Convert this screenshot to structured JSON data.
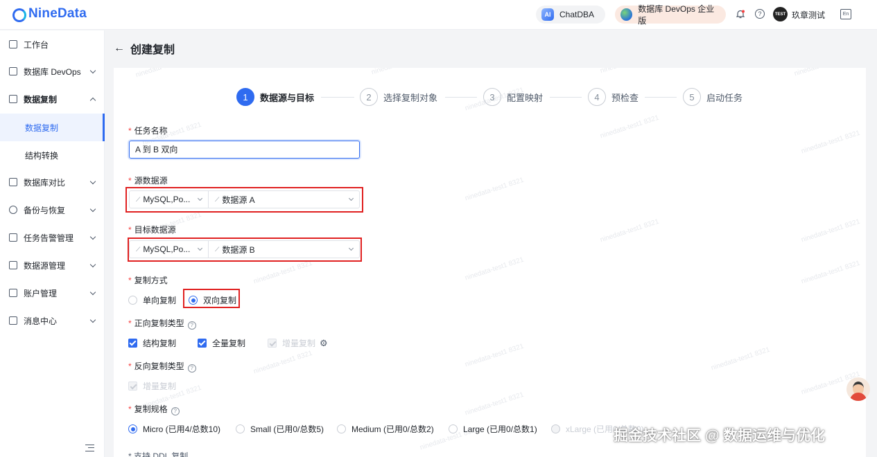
{
  "app": {
    "logo_text": "NineData",
    "brand_color": "#2f6bf0"
  },
  "topbar": {
    "chatdba_label": "ChatDBA",
    "chatdba_icon_text": "AI",
    "devops_label": "数据库 DevOps 企业版",
    "avatar_text": "TEST",
    "username": "玖章测试",
    "lang_icon_text": "En"
  },
  "sidebar": {
    "items": [
      {
        "label": "工作台",
        "icon": "home-icon"
      },
      {
        "label": "数据库 DevOps",
        "icon": "monitor-icon"
      },
      {
        "label": "数据复制",
        "icon": "copy-icon",
        "expanded": true
      },
      {
        "label": "数据复制",
        "sub": true,
        "active": true
      },
      {
        "label": "结构转换",
        "sub": true
      },
      {
        "label": "数据库对比",
        "icon": "compare-icon"
      },
      {
        "label": "备份与恢复",
        "icon": "cloud-icon"
      },
      {
        "label": "任务告警管理",
        "icon": "alarm-icon"
      },
      {
        "label": "数据源管理",
        "icon": "database-icon"
      },
      {
        "label": "账户管理",
        "icon": "account-icon"
      },
      {
        "label": "消息中心",
        "icon": "mail-icon"
      }
    ]
  },
  "page": {
    "back": "←",
    "title": "创建复制"
  },
  "steps": [
    {
      "num": "1",
      "label": "数据源与目标",
      "active": true
    },
    {
      "num": "2",
      "label": "选择复制对象"
    },
    {
      "num": "3",
      "label": "配置映射"
    },
    {
      "num": "4",
      "label": "预检查"
    },
    {
      "num": "5",
      "label": "启动任务"
    }
  ],
  "form": {
    "task_name_label": "任务名称",
    "task_name_value": "A 到 B 双向",
    "source_label": "源数据源",
    "source_type": "MySQL,Po...",
    "source_value": "数据源 A",
    "target_label": "目标数据源",
    "target_type": "MySQL,Po...",
    "target_value": "数据源 B",
    "mode_label": "复制方式",
    "mode_oneway": "单向复制",
    "mode_twoway": "双向复制",
    "forward_label": "正向复制类型",
    "forward_struct": "结构复制",
    "forward_full": "全量复制",
    "forward_incr": "增量复制",
    "reverse_label": "反向复制类型",
    "reverse_incr": "增量复制",
    "spec_label": "复制规格",
    "spec_options": [
      "Micro (已用4/总数10)",
      "Small (已用0/总数5)",
      "Medium (已用0/总数2)",
      "Large (已用0/总数1)",
      "xLarge (已用0/总数0)"
    ],
    "required_mark": "*",
    "help_mark": "?",
    "clipped_label": "* 支持 DDL 复制"
  },
  "watermark_text": "ninedata-test1 8321",
  "footer_watermark": "掘金技术社区 @ 数据运维与优化"
}
